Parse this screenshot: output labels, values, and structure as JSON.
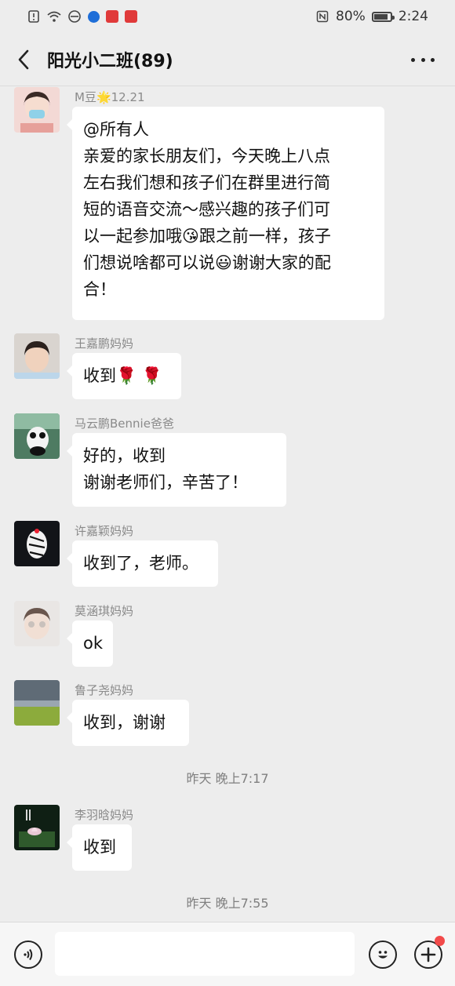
{
  "status_bar": {
    "battery": "80%",
    "time": "2:24",
    "battery_level": 0.8
  },
  "header": {
    "title": "阳光小二班(89)"
  },
  "messages": [
    {
      "sender": "M豆🌟12.21",
      "lines": [
        "@所有人",
        "亲爱的家长朋友们，今天晚上八点",
        "左右我们想和孩子们在群里进行简",
        "短的语音交流～感兴趣的孩子们可",
        "以一起参加哦😘跟之前一样，孩子",
        "们想说啥都可以说😃谢谢大家的配",
        "合！"
      ]
    },
    {
      "sender": "王嘉鹏妈妈",
      "lines": [
        "收到🌹 🌹"
      ]
    },
    {
      "sender": "马云鹏Bennie爸爸",
      "lines": [
        "好的，收到",
        "谢谢老师们，辛苦了！"
      ]
    },
    {
      "sender": "许嘉颖妈妈",
      "lines": [
        "收到了，老师。"
      ]
    },
    {
      "sender": "莫涵琪妈妈",
      "lines": [
        "ok"
      ]
    },
    {
      "sender": "鲁子尧妈妈",
      "lines": [
        "收到，谢谢"
      ]
    },
    {
      "sender": "李羽晗妈妈",
      "lines": [
        "收到"
      ]
    }
  ],
  "timestamps": [
    "昨天 晚上7:17",
    "昨天 晚上7:55"
  ],
  "input": {
    "placeholder": ""
  },
  "colors": {
    "background": "#ededed",
    "bubble": "#ffffff",
    "badge": "#f24a4a"
  }
}
